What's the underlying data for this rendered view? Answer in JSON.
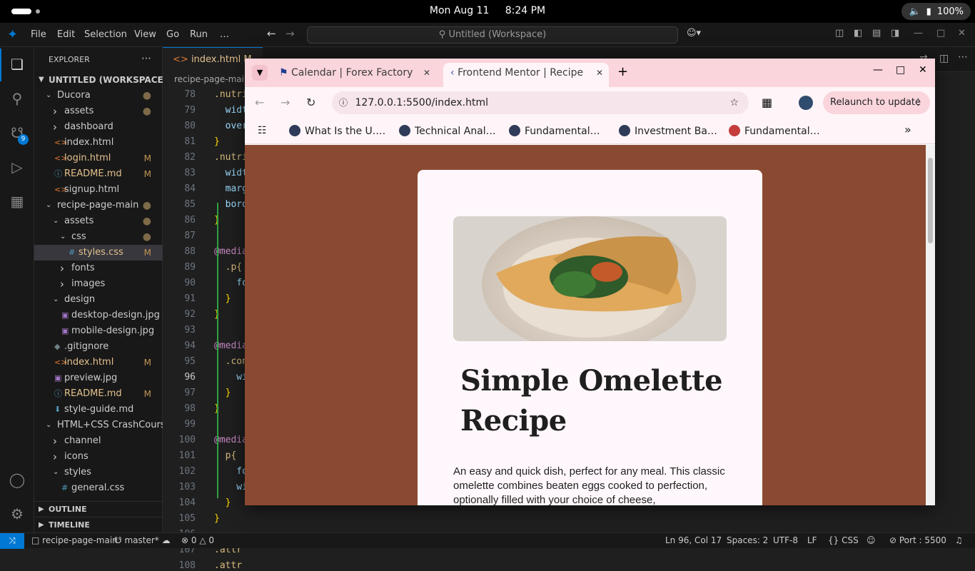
{
  "system": {
    "datetime_day": "Mon Aug 11",
    "datetime_time": "8:24 PM",
    "battery": "100%"
  },
  "vscode": {
    "menu": [
      "File",
      "Edit",
      "Selection",
      "View",
      "Go",
      "Run",
      "…"
    ],
    "command_center": "Untitled (Workspace)",
    "explorer_title": "EXPLORER",
    "workspace": "UNTITLED (WORKSPACE)",
    "scm_badge": "9",
    "tree": [
      {
        "label": "Ducora",
        "type": "folder-open",
        "depth": 1,
        "badge": "●"
      },
      {
        "label": "assets",
        "type": "folder",
        "depth": 2,
        "badge": "●"
      },
      {
        "label": "dashboard",
        "type": "folder",
        "depth": 2,
        "badge": ""
      },
      {
        "label": "index.html",
        "type": "html",
        "depth": 2,
        "badge": ""
      },
      {
        "label": "login.html",
        "type": "html",
        "depth": 2,
        "badge": "M"
      },
      {
        "label": "README.md",
        "type": "md",
        "depth": 2,
        "badge": "M"
      },
      {
        "label": "signup.html",
        "type": "html",
        "depth": 2,
        "badge": ""
      },
      {
        "label": "recipe-page-main",
        "type": "folder-open",
        "depth": 1,
        "badge": "●"
      },
      {
        "label": "assets",
        "type": "folder-open",
        "depth": 2,
        "badge": "●"
      },
      {
        "label": "css",
        "type": "folder-open",
        "depth": 3,
        "badge": "●"
      },
      {
        "label": "styles.css",
        "type": "css",
        "depth": 4,
        "badge": "M",
        "selected": true
      },
      {
        "label": "fonts",
        "type": "folder",
        "depth": 3,
        "badge": ""
      },
      {
        "label": "images",
        "type": "folder",
        "depth": 3,
        "badge": ""
      },
      {
        "label": "design",
        "type": "folder-open",
        "depth": 2,
        "badge": ""
      },
      {
        "label": "desktop-design.jpg",
        "type": "img",
        "depth": 3,
        "badge": ""
      },
      {
        "label": "mobile-design.jpg",
        "type": "img",
        "depth": 3,
        "badge": ""
      },
      {
        "label": ".gitignore",
        "type": "git",
        "depth": 2,
        "badge": ""
      },
      {
        "label": "index.html",
        "type": "html",
        "depth": 2,
        "badge": "M"
      },
      {
        "label": "preview.jpg",
        "type": "img",
        "depth": 2,
        "badge": ""
      },
      {
        "label": "README.md",
        "type": "md",
        "depth": 2,
        "badge": "M"
      },
      {
        "label": "style-guide.md",
        "type": "dl",
        "depth": 2,
        "badge": ""
      },
      {
        "label": "HTML+CSS CrashCourse",
        "type": "folder-open",
        "depth": 1,
        "badge": ""
      },
      {
        "label": "channel",
        "type": "folder",
        "depth": 2,
        "badge": ""
      },
      {
        "label": "icons",
        "type": "folder",
        "depth": 2,
        "badge": ""
      },
      {
        "label": "styles",
        "type": "folder-open",
        "depth": 2,
        "badge": ""
      },
      {
        "label": "general.css",
        "type": "css",
        "depth": 3,
        "badge": ""
      }
    ],
    "outline": "OUTLINE",
    "timeline": "TIMELINE",
    "editor_tab": "index.html",
    "editor_tab_badge": "M",
    "breadcrumb": "recipe-page-main",
    "lines": [
      {
        "n": "78",
        "t": ".nutri"
      },
      {
        "n": "79",
        "t": "  widt"
      },
      {
        "n": "80",
        "t": "  over"
      },
      {
        "n": "81",
        "t": "}"
      },
      {
        "n": "82",
        "t": ".nutri"
      },
      {
        "n": "83",
        "t": "  widt"
      },
      {
        "n": "84",
        "t": "  marg"
      },
      {
        "n": "85",
        "t": "  bord"
      },
      {
        "n": "86",
        "t": "}"
      },
      {
        "n": "87",
        "t": ""
      },
      {
        "n": "88",
        "t": "@media"
      },
      {
        "n": "89",
        "t": "  .p{"
      },
      {
        "n": "90",
        "t": "    fo"
      },
      {
        "n": "91",
        "t": "  }"
      },
      {
        "n": "92",
        "t": "}"
      },
      {
        "n": "93",
        "t": ""
      },
      {
        "n": "94",
        "t": "@media"
      },
      {
        "n": "95",
        "t": "  .con"
      },
      {
        "n": "96",
        "t": "    wi"
      },
      {
        "n": "97",
        "t": "  }"
      },
      {
        "n": "98",
        "t": "}"
      },
      {
        "n": "99",
        "t": ""
      },
      {
        "n": "100",
        "t": "@media"
      },
      {
        "n": "101",
        "t": "  p{"
      },
      {
        "n": "102",
        "t": "    fo"
      },
      {
        "n": "103",
        "t": "    wi"
      },
      {
        "n": "104",
        "t": "  }"
      },
      {
        "n": "105",
        "t": "}"
      },
      {
        "n": "106",
        "t": ""
      },
      {
        "n": "107",
        "t": ".attr"
      },
      {
        "n": "108",
        "t": ".attr"
      }
    ],
    "status": {
      "branch_folder": "recipe-page-main",
      "branch": "master*",
      "errors": "0",
      "warnings": "0",
      "cursor": "Ln 96, Col 17",
      "spaces": "Spaces: 2",
      "encoding": "UTF-8",
      "eol": "LF",
      "language": "CSS",
      "port": "Port : 5500"
    }
  },
  "chrome": {
    "tabs": [
      {
        "title": "Calendar | Forex Factory",
        "active": false
      },
      {
        "title": "Frontend Mentor | Recipe",
        "active": true
      }
    ],
    "url": "127.0.0.1:5500/index.html",
    "relaunch": "Relaunch to update",
    "bookmarks": [
      "What Is the U.…",
      "Technical Anal…",
      "Fundamental…",
      "Investment Ba…",
      "Fundamental…"
    ]
  },
  "page": {
    "title": "Simple Omelette Recipe",
    "intro": "An easy and quick dish, perfect for any meal. This classic omelette combines beaten eggs cooked to perfection, optionally filled with your choice of cheese,"
  },
  "colors": {
    "vscode_accent": "#0078d4",
    "page_bg": "#8a4a32",
    "card_bg": "#fff7fb",
    "chrome_frame": "#fad5dc"
  }
}
